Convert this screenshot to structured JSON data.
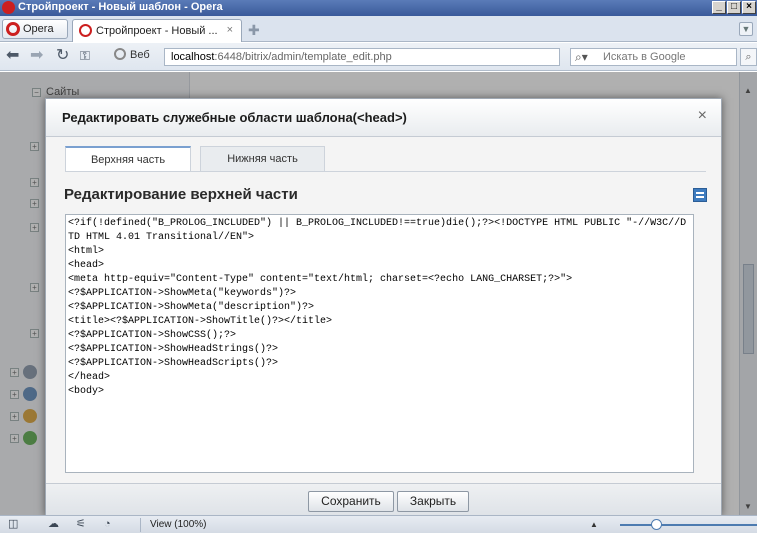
{
  "window": {
    "title": "Стройпроект - Новый шаблон - Opera",
    "buttons": [
      "_",
      "□",
      "×"
    ]
  },
  "tabs": {
    "opera_menu_label": "Opera",
    "active_tab_label": "Стройпроект - Новый ...",
    "close_glyph": "×",
    "new_tab_glyph": "✚",
    "tab_menu_glyph": "▼"
  },
  "address": {
    "web_label": "Веб",
    "url_host": "localhost",
    "url_path": ":6448/bitrix/admin/template_edit.php",
    "search_placeholder": "Искать в Google",
    "search_engine_icon": "search-icon"
  },
  "sidebar": {
    "sites_label": "Сайты",
    "items": [
      "+",
      "+",
      "+",
      "+",
      "+",
      "+",
      "+",
      "+",
      "+",
      "+"
    ]
  },
  "dialog": {
    "title": "Редактировать служебные области шаблона(<head>)",
    "close_glyph": "×",
    "tabs": [
      {
        "label": "Верхняя часть",
        "active": true
      },
      {
        "label": "Нижняя часть",
        "active": false
      }
    ],
    "section_title": "Редактирование верхней части",
    "code": "<?if(!defined(\"B_PROLOG_INCLUDED\") || B_PROLOG_INCLUDED!==true)die();?><!DOCTYPE HTML PUBLIC \"-//W3C//DTD HTML 4.01 Transitional//EN\">\n<html>\n<head>\n<meta http-equiv=\"Content-Type\" content=\"text/html; charset=<?echo LANG_CHARSET;?>\">\n<?$APPLICATION->ShowMeta(\"keywords\")?>\n<?$APPLICATION->ShowMeta(\"description\")?>\n<title><?$APPLICATION->ShowTitle()?></title>\n<?$APPLICATION->ShowCSS();?>\n<?$APPLICATION->ShowHeadStrings()?>\n<?$APPLICATION->ShowHeadScripts()?>\n</head>\n<body>",
    "save_label": "Сохранить",
    "close_label": "Закрыть"
  },
  "statusbar": {
    "zoom_text": "View (100%)"
  },
  "colors": {
    "title_bar": "#3a5a9a",
    "accent_tab": "#7aa0d0",
    "opera_red": "#cc1f1f"
  }
}
